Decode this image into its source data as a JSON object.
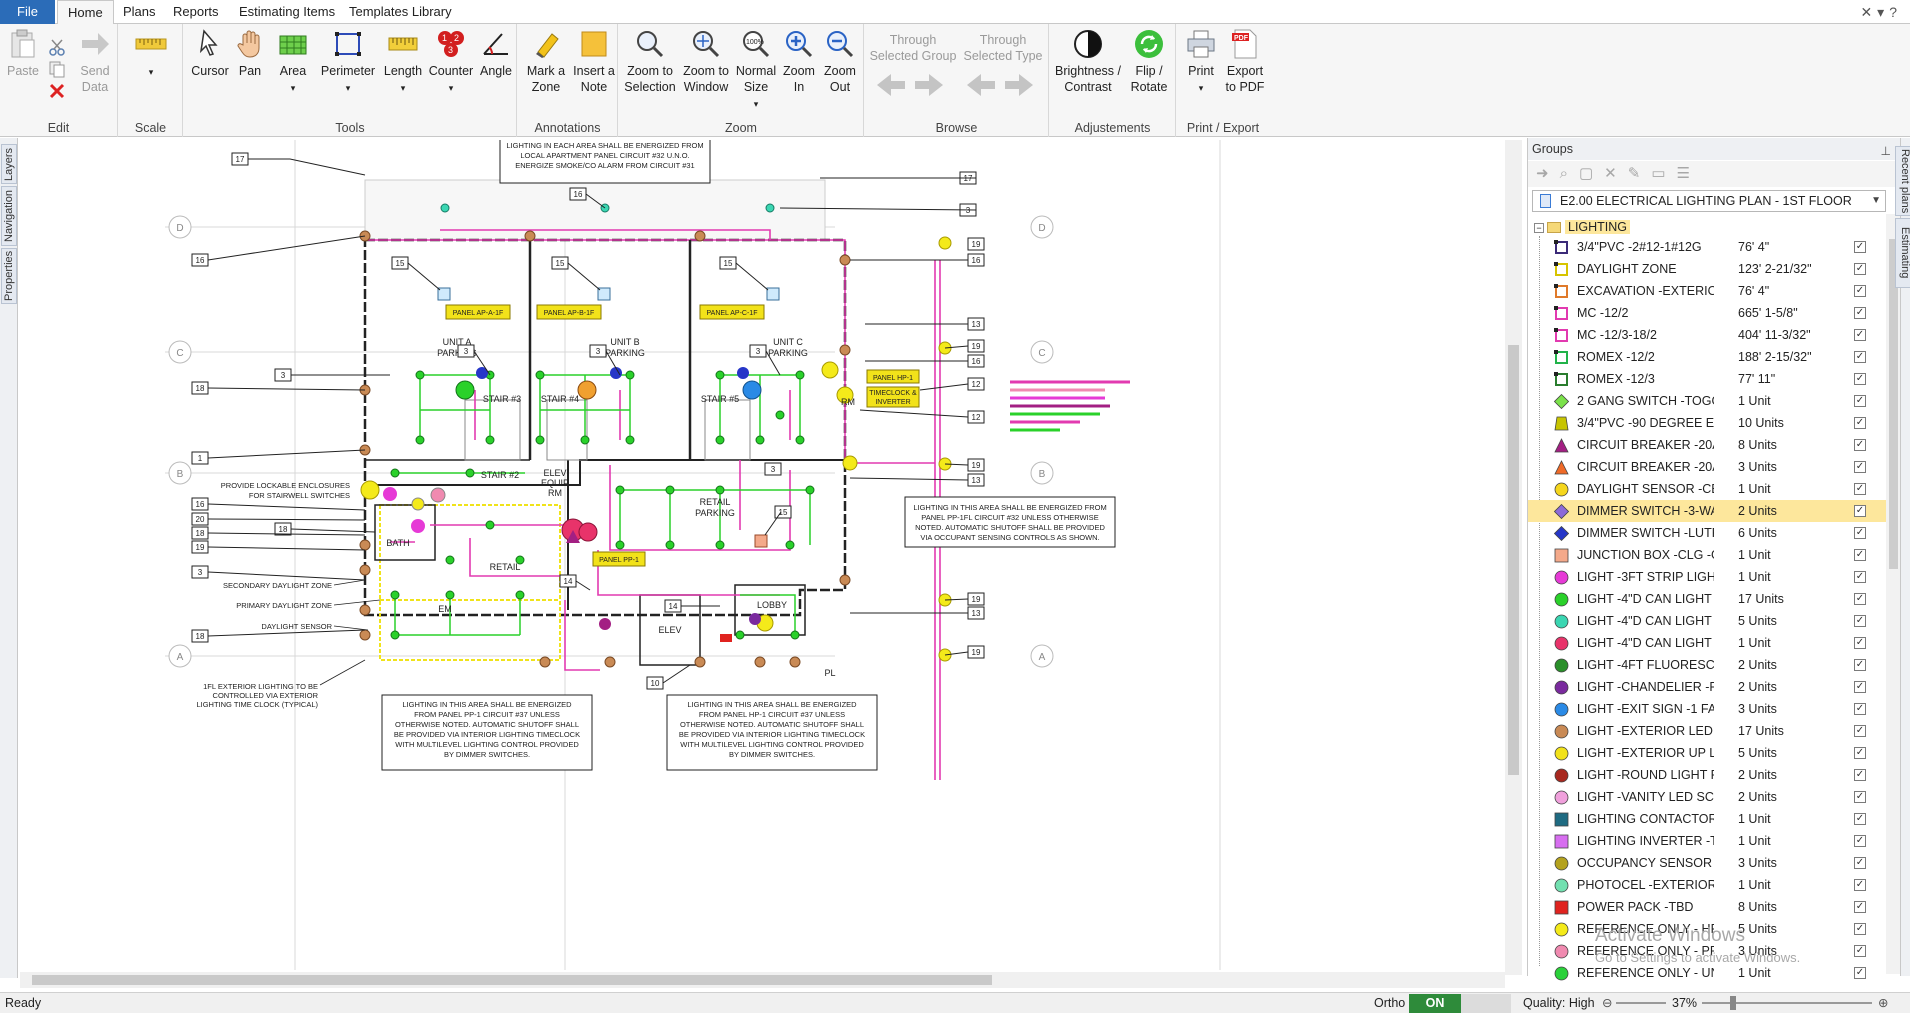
{
  "tabs": [
    "File",
    "Home",
    "Plans",
    "Reports",
    "Estimating Items",
    "Templates Library"
  ],
  "ribbon": {
    "edit": {
      "label": "Edit",
      "paste": "Paste",
      "send": "Send Data"
    },
    "scale": {
      "label": "Scale"
    },
    "tools": {
      "label": "Tools",
      "items": [
        "Cursor",
        "Pan",
        "Area",
        "Perimeter",
        "Length",
        "Counter",
        "Angle"
      ]
    },
    "annotations": {
      "label": "Annotations",
      "mark": "Mark a Zone",
      "note": "Insert a Note"
    },
    "zoom": {
      "label": "Zoom",
      "items": [
        "Zoom to Selection",
        "Zoom to Window",
        "Normal Size",
        "Zoom In",
        "Zoom Out"
      ]
    },
    "browse": {
      "label": "Browse",
      "group": "Through Selected Group",
      "type": "Through Selected Type"
    },
    "adjust": {
      "label": "Adjustements",
      "bright": "Brightness / Contrast",
      "flip": "Flip / Rotate"
    },
    "print": {
      "label": "Print / Export",
      "print": "Print",
      "export": "Export to PDF"
    }
  },
  "leftrail": [
    "Layers",
    "Navigation",
    "Properties"
  ],
  "rightrail": [
    "Recent plans",
    "Estimating"
  ],
  "panel": {
    "title": "Groups",
    "plan": "E2.00 ELECTRICAL LIGHTING PLAN - 1ST FLOOR",
    "group": "LIGHTING",
    "items": [
      {
        "name": "3/4\"PVC -2#12-1#12G",
        "qty": "76' 4\"",
        "color": "#3b2a78",
        "shape": "line"
      },
      {
        "name": "DAYLIGHT ZONE",
        "qty": "123' 2-21/32\"",
        "color": "#d7c400",
        "shape": "line"
      },
      {
        "name": "EXCAVATION -EXTERIOR",
        "qty": "76' 4\"",
        "color": "#e07a2a",
        "shape": "line"
      },
      {
        "name": "MC -12/2",
        "qty": "665' 1-5/8\"",
        "color": "#e23ab0",
        "shape": "line"
      },
      {
        "name": "MC -12/3-18/2",
        "qty": "404' 11-3/32\"",
        "color": "#e23ab0",
        "shape": "line"
      },
      {
        "name": "ROMEX -12/2",
        "qty": "188' 2-15/32\"",
        "color": "#21b34a",
        "shape": "line"
      },
      {
        "name": "ROMEX -12/3",
        "qty": "77' 11\"",
        "color": "#2a7d2e",
        "shape": "line"
      },
      {
        "name": "2 GANG SWITCH -TOGGLE...",
        "qty": "1 Unit",
        "color": "#7be24a",
        "shape": "diamond"
      },
      {
        "name": "3/4\"PVC -90 DEGREE ELBOW",
        "qty": "10 Units",
        "color": "#c7c400",
        "shape": "trap"
      },
      {
        "name": "CIRCUIT BREAKER -20A-1P...",
        "qty": "8 Units",
        "color": "#a31f83",
        "shape": "tri"
      },
      {
        "name": "CIRCUIT BREAKER -20A-1P...",
        "qty": "3 Units",
        "color": "#ef6a28",
        "shape": "tri"
      },
      {
        "name": "DAYLIGHT SENSOR -CEILING",
        "qty": "1 Unit",
        "color": "#f5d61d",
        "shape": "circle"
      },
      {
        "name": "DIMMER SWITCH -3-WAY...",
        "qty": "2 Units",
        "color": "#8d6ad8",
        "shape": "diamond"
      },
      {
        "name": "DIMMER SWITCH -LUTRO...",
        "qty": "6 Units",
        "color": "#2636c8",
        "shape": "diamond"
      },
      {
        "name": "JUNCTION BOX -CLG -GAR...",
        "qty": "1 Unit",
        "color": "#f4a98a",
        "shape": "square"
      },
      {
        "name": "LIGHT -3FT STRIP LIGHT -S...",
        "qty": "1 Unit",
        "color": "#e63ad6",
        "shape": "circle"
      },
      {
        "name": "LIGHT -4\"D CAN LIGHT -R...",
        "qty": "17 Units",
        "color": "#2ad12a",
        "shape": "circle"
      },
      {
        "name": "LIGHT -4\"D CAN LIGHT -W...",
        "qty": "5 Units",
        "color": "#3bd6b2",
        "shape": "circle"
      },
      {
        "name": "LIGHT -4\"D CAN LIGHT w/...",
        "qty": "1 Unit",
        "color": "#e8336a",
        "shape": "circle"
      },
      {
        "name": "LIGHT -4FT FLUORESCENT...",
        "qty": "2 Units",
        "color": "#2a8f2a",
        "shape": "circle"
      },
      {
        "name": "LIGHT -CHANDELIER -PEN...",
        "qty": "2 Units",
        "color": "#7a2a9e",
        "shape": "circle"
      },
      {
        "name": "LIGHT -EXIT SIGN -1 FACE...",
        "qty": "3 Units",
        "color": "#2a8ae6",
        "shape": "circle"
      },
      {
        "name": "LIGHT -EXTERIOR LED SCO...",
        "qty": "17 Units",
        "color": "#c98a55",
        "shape": "circle"
      },
      {
        "name": "LIGHT -EXTERIOR UP LIGH...",
        "qty": "5 Units",
        "color": "#f2e21a",
        "shape": "circle"
      },
      {
        "name": "LIGHT -ROUND LIGHT FIXT...",
        "qty": "2 Units",
        "color": "#a8281f",
        "shape": "circle"
      },
      {
        "name": "LIGHT -VANITY LED SCON...",
        "qty": "2 Units",
        "color": "#f0a0dc",
        "shape": "circle"
      },
      {
        "name": "LIGHTING CONTACTOR -6...",
        "qty": "1 Unit",
        "color": "#1f6b82",
        "shape": "square"
      },
      {
        "name": "LIGHTING INVERTER -TBD",
        "qty": "1 Unit",
        "color": "#d76ef0",
        "shape": "square"
      },
      {
        "name": "OCCUPANCY SENSOR -CEI...",
        "qty": "3 Units",
        "color": "#b4a21e",
        "shape": "circle"
      },
      {
        "name": "PHOTOCEL -EXTERIOR -TBD",
        "qty": "1 Unit",
        "color": "#72e0b0",
        "shape": "circle"
      },
      {
        "name": "POWER PACK -TBD",
        "qty": "8 Units",
        "color": "#e0231f",
        "shape": "square"
      },
      {
        "name": "REFERENCE ONLY - HP1 -...",
        "qty": "5 Units",
        "color": "#f4ea1a",
        "shape": "circle"
      },
      {
        "name": "REFERENCE ONLY - PP1 CKT...",
        "qty": "3 Units",
        "color": "#f08ab0",
        "shape": "circle"
      },
      {
        "name": "REFERENCE ONLY - UNIT A...",
        "qty": "1 Unit",
        "color": "#2ad13a",
        "shape": "circle"
      }
    ]
  },
  "plan": {
    "note_top": [
      "LIGHTING IN EACH AREA SHALL BE ENERGIZED FROM",
      "LOCAL APARTMENT PANEL CIRCUIT #32 U.N.O.",
      "ENERGIZE SMOKE/CO ALARM FROM CIRCUIT #31"
    ],
    "note_right": [
      "LIGHTING IN THIS AREA SHALL BE ENERGIZED FROM",
      "PANEL PP-1FL CIRCUIT #32 UNLESS OTHERWISE",
      "NOTED. AUTOMATIC SHUTOFF SHALL BE PROVIDED",
      "VIA OCCUPANT SENSING CONTROLS AS SHOWN."
    ],
    "note_bl": [
      "LIGHTING IN THIS AREA SHALL BE ENERGIZED",
      "FROM PANEL PP-1 CIRCUIT #37 UNLESS",
      "OTHERWISE NOTED. AUTOMATIC SHUTOFF SHALL",
      "BE PROVIDED VIA INTERIOR LIGHTING TIMECLOCK",
      "WITH MULTILEVEL LIGHTING CONTROL PROVIDED",
      "BY DIMMER SWITCHES."
    ],
    "note_bm": [
      "LIGHTING IN THIS AREA SHALL BE ENERGIZED",
      "FROM PANEL HP-1 CIRCUIT #37 UNLESS",
      "OTHERWISE NOTED. AUTOMATIC SHUTOFF SHALL",
      "BE PROVIDED VIA INTERIOR LIGHTING TIMECLOCK",
      "WITH MULTILEVEL LIGHTING CONTROL PROVIDED",
      "BY DIMMER SWITCHES."
    ],
    "labels": {
      "unitA": "UNIT A",
      "unitB": "UNIT B",
      "unitC": "UNIT C",
      "parking": "PARKING",
      "stair3": "STAIR #3",
      "stair4": "STAIR #4",
      "stair5": "STAIR #5",
      "stair2": "STAIR #2",
      "elev": "ELEV",
      "equip": "EQUIP",
      "rm": "RM",
      "retail": "RETAIL",
      "retailParking": "RETAIL",
      "retailParking2": "PARKING",
      "bath": "BATH",
      "lobby": "LOBBY",
      "pl": "PL",
      "em": "EM"
    },
    "panels": [
      "PANEL AP-A-1F",
      "PANEL AP-B-1F",
      "PANEL AP-C-1F",
      "PANEL HP-1",
      "TIMECLOCK &",
      "INVERTER",
      "PANEL PP-1"
    ],
    "side": {
      "enclosure1": "PROVIDE LOCKABLE ENCLOSURES",
      "enclosure2": "FOR STAIRWELL SWITCHES",
      "secondary": "SECONDARY DAYLIGHT ZONE",
      "primary": "PRIMARY DAYLIGHT ZONE",
      "sensor": "DAYLIGHT SENSOR",
      "ext1": "1FL EXTERIOR LIGHTING TO BE",
      "ext2": "CONTROLLED VIA EXTERIOR",
      "ext3": "LIGHTING TIME CLOCK (TYPICAL)"
    },
    "tags": [
      "17",
      "16",
      "3",
      "18",
      "15",
      "15",
      "15",
      "3",
      "3",
      "3",
      "3",
      "3",
      "3",
      "18",
      "1",
      "16",
      "20",
      "18",
      "19",
      "18",
      "3",
      "18",
      "17",
      "3",
      "16",
      "13",
      "19",
      "16",
      "12",
      "12",
      "19",
      "13",
      "15",
      "14",
      "14",
      "19",
      "13",
      "19",
      "10"
    ],
    "grid": [
      "D",
      "C",
      "B",
      "A"
    ]
  },
  "status": {
    "ready": "Ready",
    "ortho": "Ortho",
    "on": "ON",
    "quality": "Quality: High",
    "zoom": "37%"
  },
  "watermark": {
    "line1": "Activate Windows",
    "line2": "Go to Settings to activate Windows."
  }
}
